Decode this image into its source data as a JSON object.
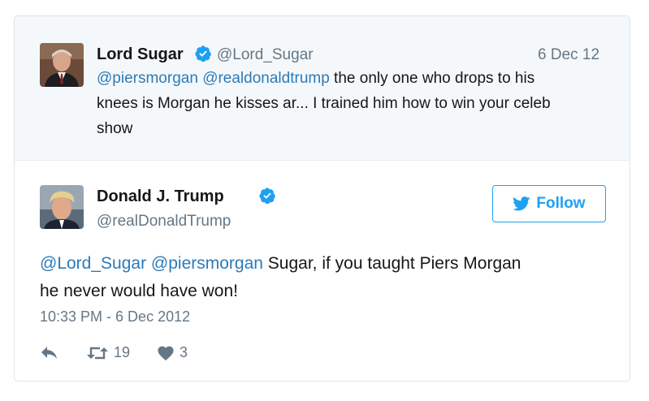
{
  "reply_tweet": {
    "name": "Lord Sugar",
    "handle": "@Lord_Sugar",
    "date": "6 Dec 12",
    "mentions": [
      "@piersmorgan",
      "@realdonaldtrump"
    ],
    "text_line1_rest": " the only one who drops to his",
    "text_line2": "knees is Morgan he kisses ar... I trained him how to win your celeb",
    "text_line3": "show",
    "avatar_icon": "lord-sugar-avatar"
  },
  "main_tweet": {
    "name": "Donald J. Trump",
    "handle": "@realDonaldTrump",
    "follow_label": "Follow",
    "mentions": [
      "@Lord_Sugar",
      "@piersmorgan"
    ],
    "text_line1_rest": " Sugar, if you taught Piers Morgan",
    "text_line2": "he never would have won!",
    "timestamp": "10:33 PM - 6 Dec 2012",
    "retweet_count": "19",
    "like_count": "3",
    "avatar_icon": "donald-trump-avatar"
  },
  "icons": {
    "verified": "verified-badge-icon",
    "twitter_bird": "twitter-bird-icon",
    "reply": "reply-icon",
    "retweet": "retweet-icon",
    "like": "heart-icon"
  },
  "colors": {
    "link": "#2b7bb9",
    "twitter_blue": "#1da1f2",
    "muted": "#657786",
    "reply_bg": "#f5f8fa"
  }
}
